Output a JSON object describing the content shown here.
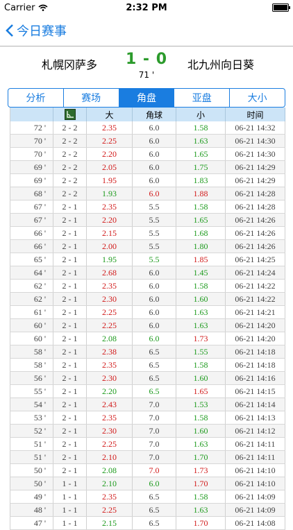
{
  "status_bar": {
    "carrier": "Carrier",
    "time": "2:32 PM"
  },
  "nav": {
    "back_label": "今日赛事"
  },
  "match": {
    "home": "札幌冈萨多",
    "away": "北九州向日葵",
    "score": "1 - 0",
    "minute": "71 '"
  },
  "tabs": [
    {
      "label": "分析",
      "active": false
    },
    {
      "label": "赛场",
      "active": false
    },
    {
      "label": "角盘",
      "active": true
    },
    {
      "label": "亚盘",
      "active": false
    },
    {
      "label": "大小",
      "active": false
    }
  ],
  "table": {
    "headers": [
      "",
      "",
      "大",
      "角球",
      "小",
      "时间"
    ],
    "rows": [
      {
        "min": "72 '",
        "score": "2 - 2",
        "big": "2.35",
        "big_c": "red",
        "line": "6.0",
        "line_c": "",
        "small": "1.58",
        "small_c": "green",
        "time": "06-21 14:32"
      },
      {
        "min": "70 '",
        "score": "2 - 2",
        "big": "2.25",
        "big_c": "red",
        "line": "6.0",
        "line_c": "",
        "small": "1.63",
        "small_c": "green",
        "time": "06-21 14:30"
      },
      {
        "min": "70 '",
        "score": "2 - 2",
        "big": "2.20",
        "big_c": "red",
        "line": "6.0",
        "line_c": "",
        "small": "1.65",
        "small_c": "green",
        "time": "06-21 14:30"
      },
      {
        "min": "69 '",
        "score": "2 - 2",
        "big": "2.05",
        "big_c": "red",
        "line": "6.0",
        "line_c": "",
        "small": "1.75",
        "small_c": "green",
        "time": "06-21 14:29"
      },
      {
        "min": "69 '",
        "score": "2 - 2",
        "big": "1.95",
        "big_c": "red",
        "line": "6.0",
        "line_c": "",
        "small": "1.83",
        "small_c": "green",
        "time": "06-21 14:29"
      },
      {
        "min": "68 '",
        "score": "2 - 2",
        "big": "1.93",
        "big_c": "green",
        "line": "6.0",
        "line_c": "red",
        "small": "1.88",
        "small_c": "red",
        "time": "06-21 14:28"
      },
      {
        "min": "67 '",
        "score": "2 - 1",
        "big": "2.35",
        "big_c": "red",
        "line": "5.5",
        "line_c": "",
        "small": "1.58",
        "small_c": "green",
        "time": "06-21 14:28"
      },
      {
        "min": "67 '",
        "score": "2 - 1",
        "big": "2.20",
        "big_c": "red",
        "line": "5.5",
        "line_c": "",
        "small": "1.65",
        "small_c": "green",
        "time": "06-21 14:26"
      },
      {
        "min": "66 '",
        "score": "2 - 1",
        "big": "2.15",
        "big_c": "red",
        "line": "5.5",
        "line_c": "",
        "small": "1.68",
        "small_c": "green",
        "time": "06-21 14:26"
      },
      {
        "min": "66 '",
        "score": "2 - 1",
        "big": "2.00",
        "big_c": "red",
        "line": "5.5",
        "line_c": "",
        "small": "1.80",
        "small_c": "green",
        "time": "06-21 14:26"
      },
      {
        "min": "65 '",
        "score": "2 - 1",
        "big": "1.95",
        "big_c": "green",
        "line": "5.5",
        "line_c": "green",
        "small": "1.85",
        "small_c": "red",
        "time": "06-21 14:25"
      },
      {
        "min": "64 '",
        "score": "2 - 1",
        "big": "2.68",
        "big_c": "red",
        "line": "6.0",
        "line_c": "",
        "small": "1.45",
        "small_c": "green",
        "time": "06-21 14:24"
      },
      {
        "min": "62 '",
        "score": "2 - 1",
        "big": "2.35",
        "big_c": "red",
        "line": "6.0",
        "line_c": "",
        "small": "1.58",
        "small_c": "green",
        "time": "06-21 14:22"
      },
      {
        "min": "62 '",
        "score": "2 - 1",
        "big": "2.30",
        "big_c": "red",
        "line": "6.0",
        "line_c": "",
        "small": "1.60",
        "small_c": "green",
        "time": "06-21 14:22"
      },
      {
        "min": "61 '",
        "score": "2 - 1",
        "big": "2.25",
        "big_c": "red",
        "line": "6.0",
        "line_c": "",
        "small": "1.63",
        "small_c": "green",
        "time": "06-21 14:21"
      },
      {
        "min": "60 '",
        "score": "2 - 1",
        "big": "2.25",
        "big_c": "red",
        "line": "6.0",
        "line_c": "",
        "small": "1.63",
        "small_c": "green",
        "time": "06-21 14:20"
      },
      {
        "min": "60 '",
        "score": "2 - 1",
        "big": "2.08",
        "big_c": "green",
        "line": "6.0",
        "line_c": "green",
        "small": "1.73",
        "small_c": "red",
        "time": "06-21 14:20"
      },
      {
        "min": "58 '",
        "score": "2 - 1",
        "big": "2.38",
        "big_c": "red",
        "line": "6.5",
        "line_c": "",
        "small": "1.55",
        "small_c": "green",
        "time": "06-21 14:18"
      },
      {
        "min": "58 '",
        "score": "2 - 1",
        "big": "2.35",
        "big_c": "red",
        "line": "6.5",
        "line_c": "",
        "small": "1.58",
        "small_c": "green",
        "time": "06-21 14:18"
      },
      {
        "min": "56 '",
        "score": "2 - 1",
        "big": "2.30",
        "big_c": "red",
        "line": "6.5",
        "line_c": "",
        "small": "1.60",
        "small_c": "green",
        "time": "06-21 14:16"
      },
      {
        "min": "55 '",
        "score": "2 - 1",
        "big": "2.20",
        "big_c": "green",
        "line": "6.5",
        "line_c": "green",
        "small": "1.65",
        "small_c": "red",
        "time": "06-21 14:15"
      },
      {
        "min": "54 '",
        "score": "2 - 1",
        "big": "2.43",
        "big_c": "red",
        "line": "7.0",
        "line_c": "",
        "small": "1.53",
        "small_c": "green",
        "time": "06-21 14:14"
      },
      {
        "min": "53 '",
        "score": "2 - 1",
        "big": "2.35",
        "big_c": "red",
        "line": "7.0",
        "line_c": "",
        "small": "1.58",
        "small_c": "green",
        "time": "06-21 14:13"
      },
      {
        "min": "52 '",
        "score": "2 - 1",
        "big": "2.30",
        "big_c": "red",
        "line": "7.0",
        "line_c": "",
        "small": "1.60",
        "small_c": "green",
        "time": "06-21 14:12"
      },
      {
        "min": "51 '",
        "score": "2 - 1",
        "big": "2.25",
        "big_c": "red",
        "line": "7.0",
        "line_c": "",
        "small": "1.63",
        "small_c": "green",
        "time": "06-21 14:11"
      },
      {
        "min": "51 '",
        "score": "2 - 1",
        "big": "2.10",
        "big_c": "red",
        "line": "7.0",
        "line_c": "",
        "small": "1.70",
        "small_c": "green",
        "time": "06-21 14:11"
      },
      {
        "min": "50 '",
        "score": "2 - 1",
        "big": "2.08",
        "big_c": "green",
        "line": "7.0",
        "line_c": "red",
        "small": "1.73",
        "small_c": "red",
        "time": "06-21 14:10"
      },
      {
        "min": "50 '",
        "score": "1 - 1",
        "big": "2.10",
        "big_c": "green",
        "line": "6.0",
        "line_c": "green",
        "small": "1.70",
        "small_c": "red",
        "time": "06-21 14:10"
      },
      {
        "min": "49 '",
        "score": "1 - 1",
        "big": "2.35",
        "big_c": "red",
        "line": "6.5",
        "line_c": "",
        "small": "1.58",
        "small_c": "green",
        "time": "06-21 14:09"
      },
      {
        "min": "48 '",
        "score": "1 - 1",
        "big": "2.25",
        "big_c": "red",
        "line": "6.5",
        "line_c": "",
        "small": "1.63",
        "small_c": "green",
        "time": "06-21 14:09"
      },
      {
        "min": "47 '",
        "score": "1 - 1",
        "big": "2.15",
        "big_c": "green",
        "line": "6.5",
        "line_c": "",
        "small": "1.70",
        "small_c": "red",
        "time": "06-21 14:08"
      }
    ]
  },
  "colors": {
    "accent": "#1a7de0",
    "score": "#2c9b2c",
    "up": "#d11a1a",
    "down": "#1c9a1c"
  }
}
